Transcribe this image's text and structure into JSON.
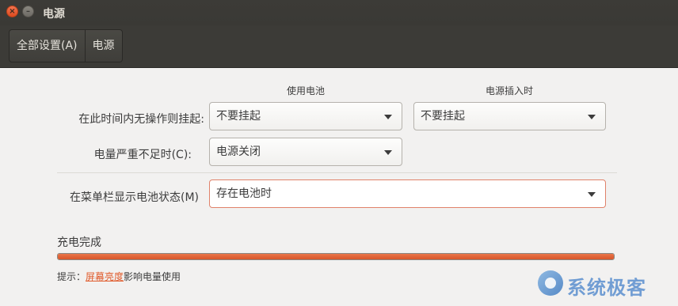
{
  "window": {
    "title": "电源",
    "close_glyph": "×",
    "minimize_glyph": "–"
  },
  "breadcrumb": {
    "all_settings": "全部设置(A)",
    "current": "电源"
  },
  "columns": {
    "battery": "使用电池",
    "plugged_in": "电源插入时"
  },
  "suspend": {
    "label": "在此时间内无操作则挂起:",
    "battery_value": "不要挂起",
    "plugged_value": "不要挂起"
  },
  "critical": {
    "label": "电量严重不足时(C):",
    "value": "电源关闭"
  },
  "menubar": {
    "label": "在菜单栏显示电池状态(M)",
    "value": "存在电池时"
  },
  "battery_status": {
    "label": "充电完成",
    "level_percent": 100
  },
  "hint": {
    "prefix": "提示：",
    "link": "屏幕亮度",
    "suffix": "影响电量使用"
  },
  "watermark": {
    "text": "系统极客"
  },
  "colors": {
    "accent": "#e05a2b",
    "progress_fill": "#d8562a",
    "titlebar": "#3c3b37",
    "focus_border": "#e0826a"
  }
}
